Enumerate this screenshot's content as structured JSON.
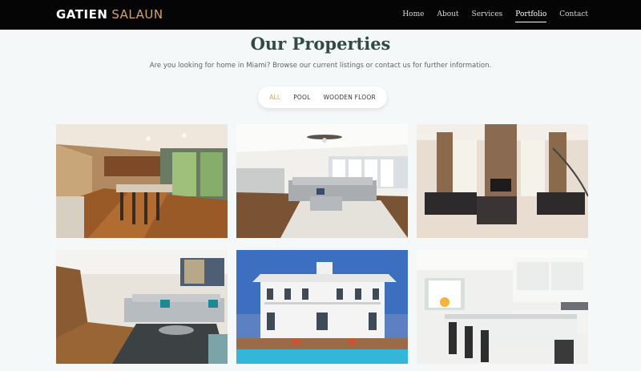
{
  "header": {
    "logo_first": "GATIEN",
    "logo_second": "SALAUN",
    "nav": [
      "Home",
      "About",
      "Services",
      "Portfolio",
      "Contact"
    ],
    "active_nav": "Portfolio"
  },
  "main": {
    "title": "Our Properties",
    "subtitle": "Are you looking for home in Miami? Browse our current listings or contact us for further information.",
    "filters": [
      "ALL",
      "POOL",
      "WOODEN FLOOR"
    ],
    "active_filter": "ALL",
    "gallery": [
      {
        "kind": "kitchen-wood"
      },
      {
        "kind": "living-open"
      },
      {
        "kind": "luxury-living"
      },
      {
        "kind": "living-stairs"
      },
      {
        "kind": "house-pool"
      },
      {
        "kind": "kitchen-white"
      }
    ]
  },
  "colors": {
    "accent": "#d4a36a",
    "topbar": "#050505",
    "title": "#304a44"
  }
}
